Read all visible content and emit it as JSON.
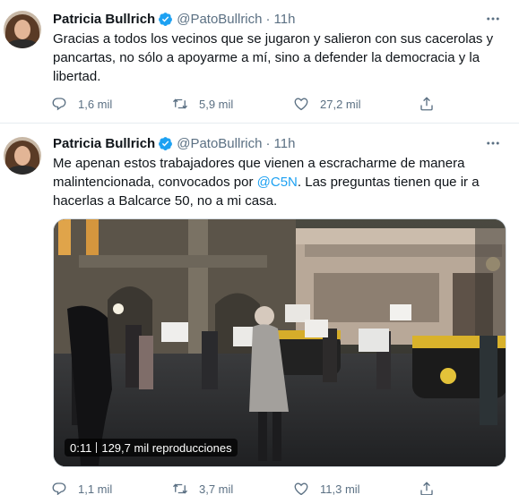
{
  "tweets": [
    {
      "author": "Patricia Bullrich",
      "handle": "@PatoBullrich",
      "separator": "·",
      "time": "11h",
      "text": "Gracias a todos los vecinos que se jugaron y salieron con sus cacerolas y pancartas, no sólo a apoyarme a mí, sino a defender la democracia y la libertad.",
      "replies": "1,6 mil",
      "retweets": "5,9 mil",
      "likes": "27,2 mil"
    },
    {
      "author": "Patricia Bullrich",
      "handle": "@PatoBullrich",
      "separator": "·",
      "time": "11h",
      "text_before": "Me apenan estos trabajadores que vienen a escracharme de manera malintencionada, convocados por ",
      "mention": "@C5N",
      "text_after": ". Las preguntas tienen que ir a hacerlas a Balcarce 50, no a mi casa.",
      "video": {
        "duration": "0:11",
        "views": "129,7 mil reproducciones"
      },
      "replies": "1,1 mil",
      "retweets": "3,7 mil",
      "likes": "11,3 mil"
    }
  ],
  "icons": {
    "verified": "verified-badge-icon",
    "more": "more-options-icon",
    "reply": "reply-icon",
    "retweet": "retweet-icon",
    "like": "like-icon",
    "share": "share-icon"
  },
  "colors": {
    "accent": "#1da1f2",
    "secondary_text": "#5b7083",
    "primary_text": "#0f1419",
    "divider": "#e6ecf0"
  }
}
